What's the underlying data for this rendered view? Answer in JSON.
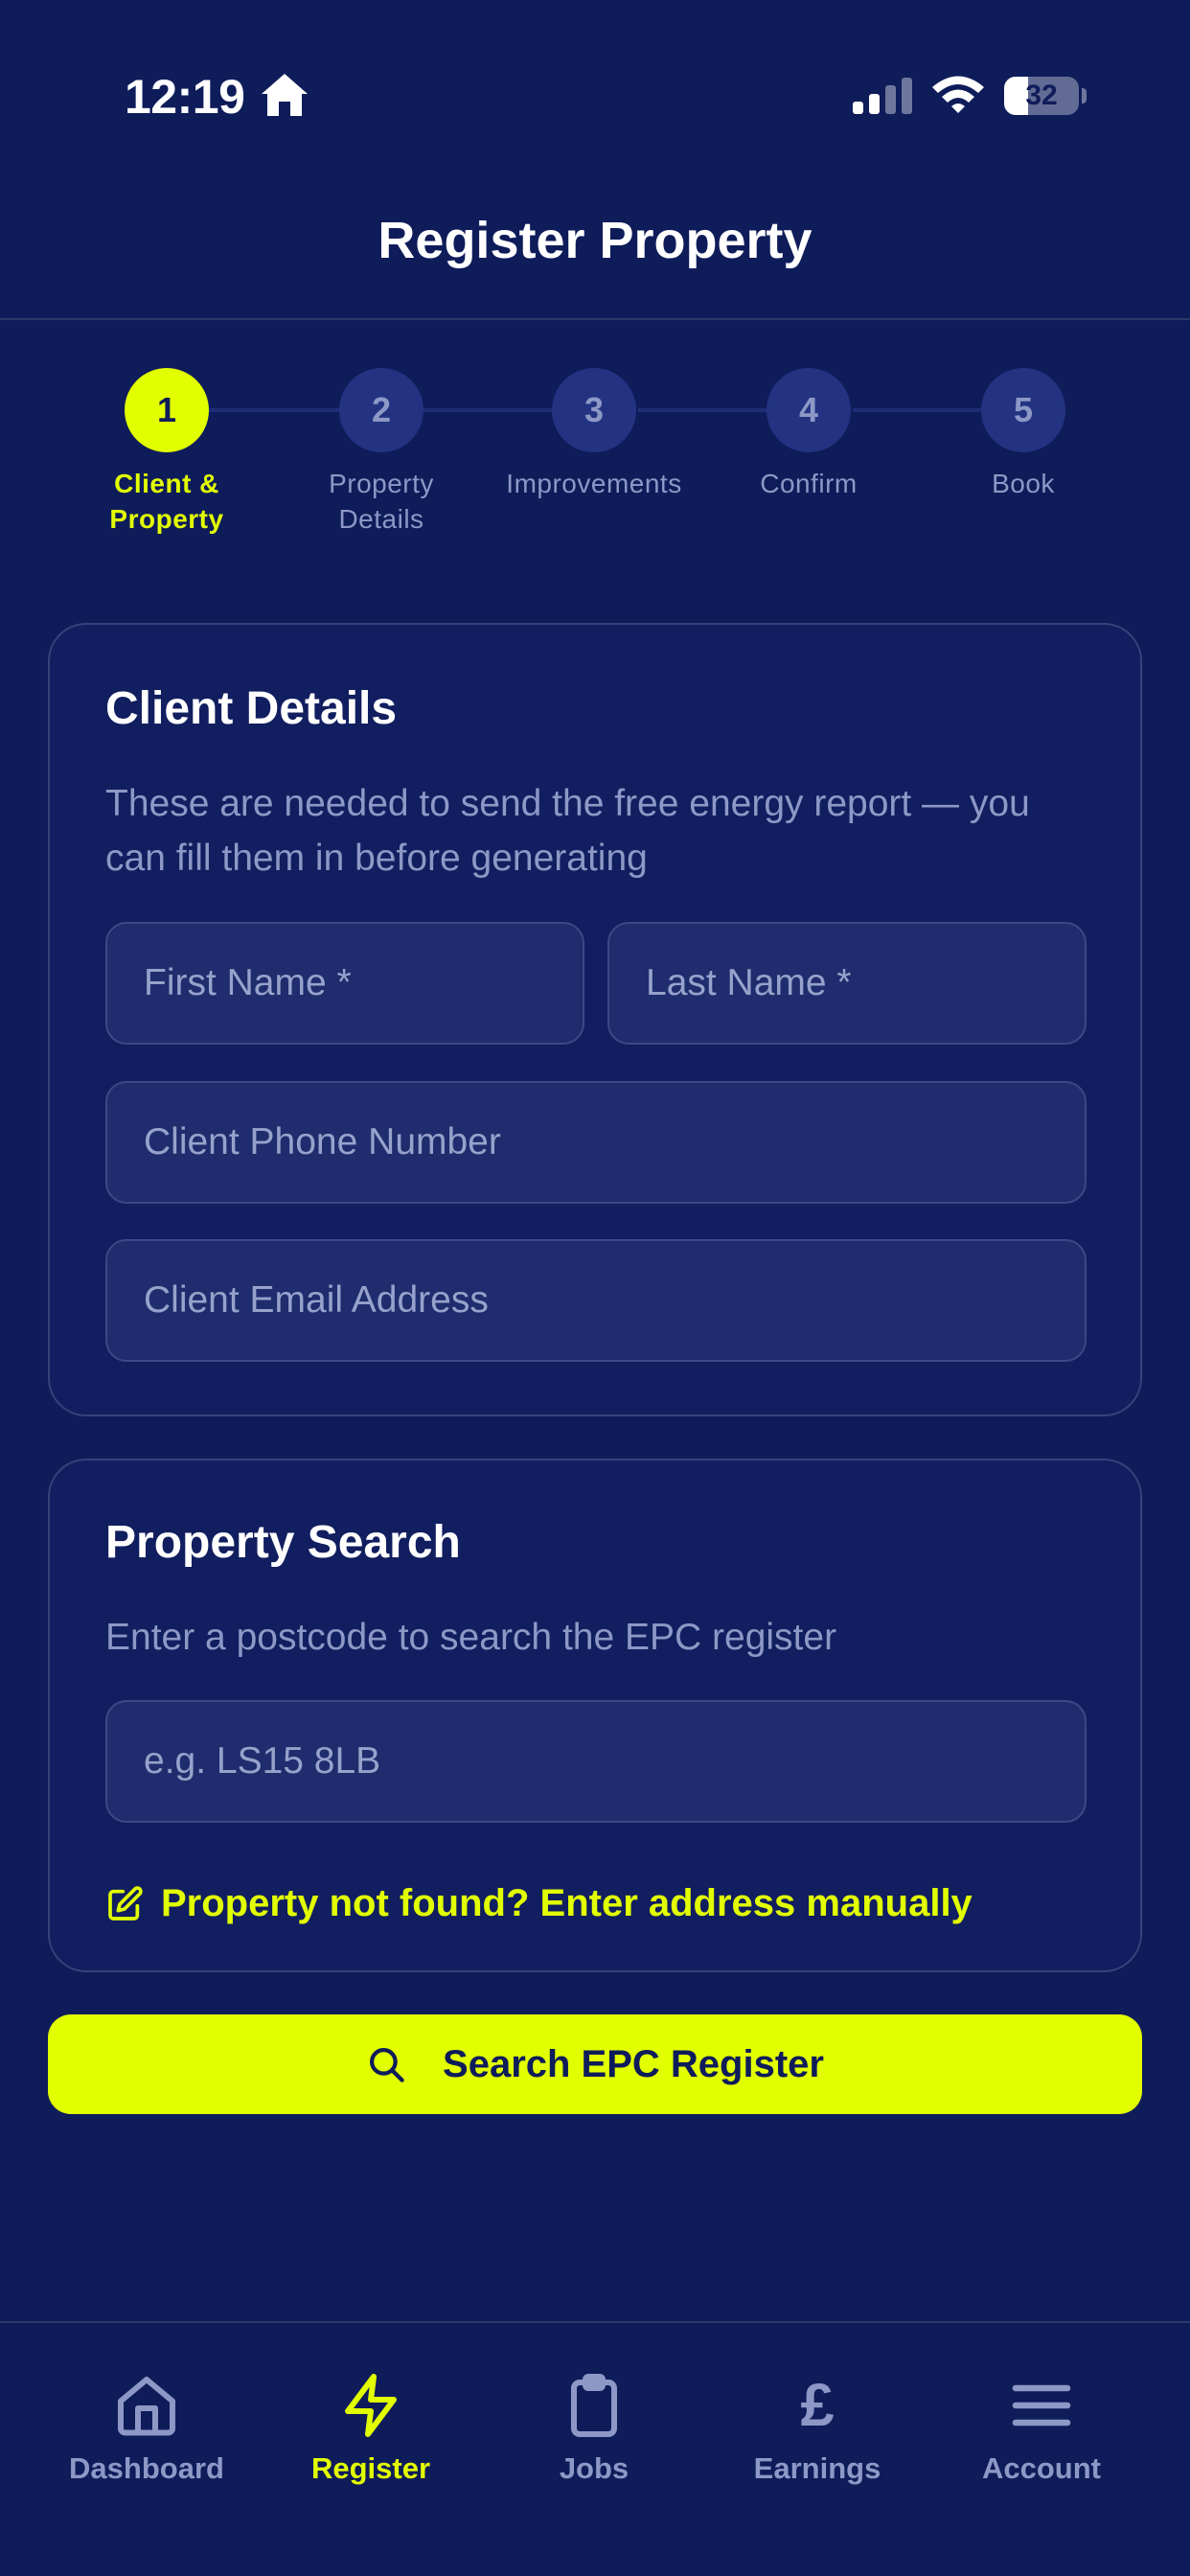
{
  "status_bar": {
    "time": "12:19",
    "battery": "32",
    "battery_level": 0.32
  },
  "header": {
    "title": "Register Property"
  },
  "stepper": {
    "steps": [
      {
        "number": "1",
        "label": "Client & Property",
        "active": true
      },
      {
        "number": "2",
        "label": "Property Details",
        "active": false
      },
      {
        "number": "3",
        "label": "Improvements",
        "active": false
      },
      {
        "number": "4",
        "label": "Confirm",
        "active": false
      },
      {
        "number": "5",
        "label": "Book",
        "active": false
      }
    ]
  },
  "client_details": {
    "title": "Client Details",
    "description": "These are needed to send the free energy report — you can fill them in before generating",
    "first_name": {
      "placeholder": "First Name *",
      "value": ""
    },
    "last_name": {
      "placeholder": "Last Name *",
      "value": ""
    },
    "phone": {
      "placeholder": "Client Phone Number",
      "value": ""
    },
    "email": {
      "placeholder": "Client Email Address",
      "value": ""
    }
  },
  "property_search": {
    "title": "Property Search",
    "description": "Enter a postcode to search the EPC register",
    "postcode": {
      "placeholder": "e.g. LS15 8LB",
      "value": ""
    },
    "manual_link": "Property not found? Enter address manually",
    "manual_icon": "edit-icon"
  },
  "search_button": {
    "label": "Search EPC Register",
    "icon": "search-icon"
  },
  "bottom_nav": {
    "items": [
      {
        "label": "Dashboard",
        "icon": "home-icon",
        "active": false
      },
      {
        "label": "Register",
        "icon": "lightning-icon",
        "active": true
      },
      {
        "label": "Jobs",
        "icon": "clipboard-icon",
        "active": false
      },
      {
        "label": "Earnings",
        "icon": "pound-icon",
        "active": false
      },
      {
        "label": "Account",
        "icon": "menu-icon",
        "active": false
      }
    ]
  },
  "colors": {
    "background": "#0f1c5a",
    "accent": "#e2ff00",
    "muted_text": "#8d98c6",
    "input_background": "#1f2c6d"
  }
}
